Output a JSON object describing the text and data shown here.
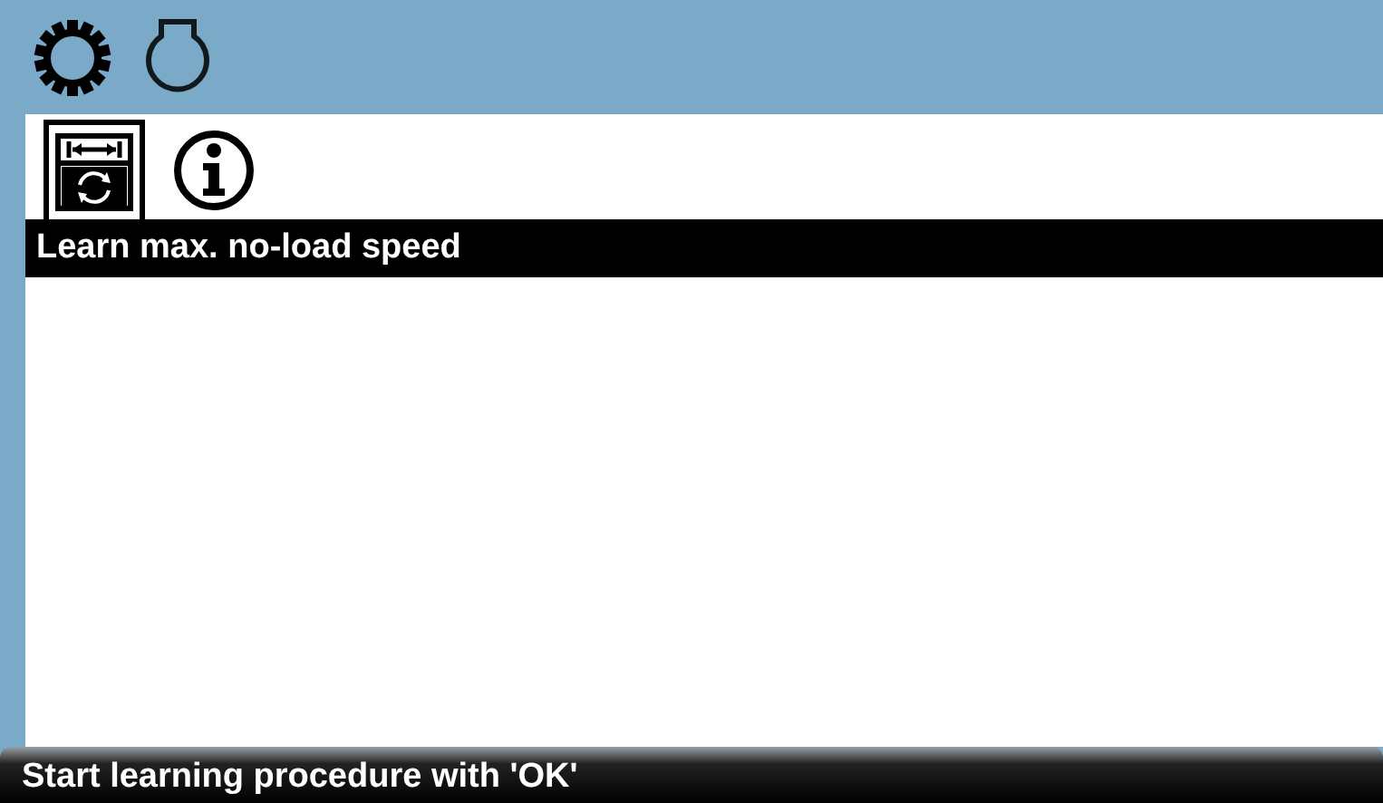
{
  "menu_tabs": [
    {
      "kind": "gear",
      "selected": true
    },
    {
      "kind": "motor",
      "selected": false
    }
  ],
  "sub_tabs": [
    {
      "kind": "learn",
      "selected": true
    },
    {
      "kind": "info",
      "selected": false
    }
  ],
  "title": "Learn max. no-load speed",
  "status_bar": "Start learning procedure with 'OK'"
}
